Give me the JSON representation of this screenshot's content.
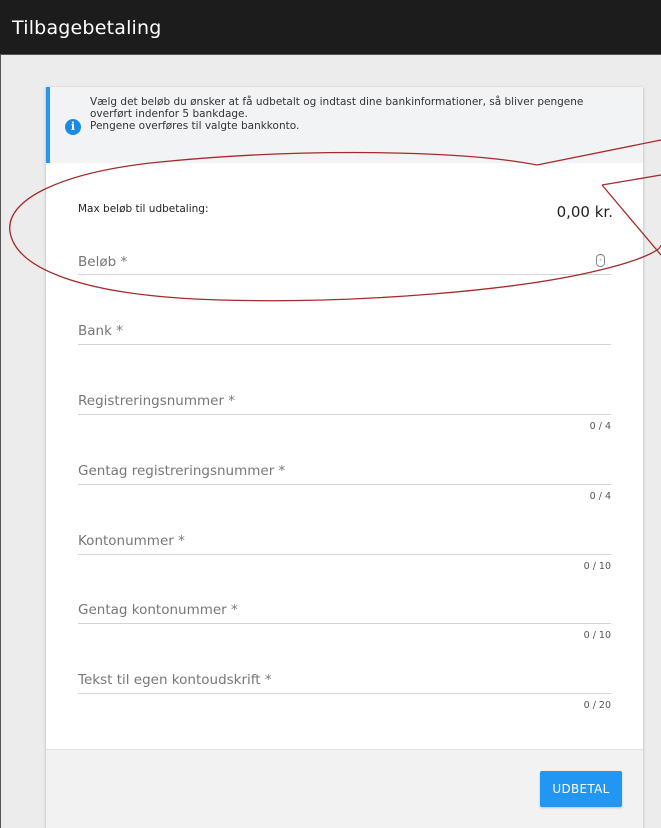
{
  "header": {
    "title": "Tilbagebetaling"
  },
  "info": {
    "icon": "info-icon",
    "lines": [
      "Vælg det beløb du ønsker at få udbetalt og indtast dine bankinformationer, så bliver pengene",
      "overført indenfor 5 bankdage.",
      "Pengene overføres til valgte bankkonto."
    ]
  },
  "max": {
    "label": "Max beløb til udbetaling:",
    "value": "0,00 kr."
  },
  "fields": [
    {
      "label": "Beløb *",
      "counter": ""
    },
    {
      "label": "Bank *",
      "counter": ""
    },
    {
      "label": "Registreringsnummer *",
      "counter": "0 / 4"
    },
    {
      "label": "Gentag registreringsnummer *",
      "counter": "0 / 4"
    },
    {
      "label": "Kontonummer *",
      "counter": "0 / 10"
    },
    {
      "label": "Gentag kontonummer *",
      "counter": "0 / 10"
    },
    {
      "label": "Tekst til egen kontoudskrift *",
      "counter": "0 / 20"
    }
  ],
  "footer": {
    "submit_label": "UDBETAL"
  },
  "colors": {
    "accent": "#2196f3",
    "annotation": "#a52a2a",
    "header_bg": "#1c1c1c"
  }
}
